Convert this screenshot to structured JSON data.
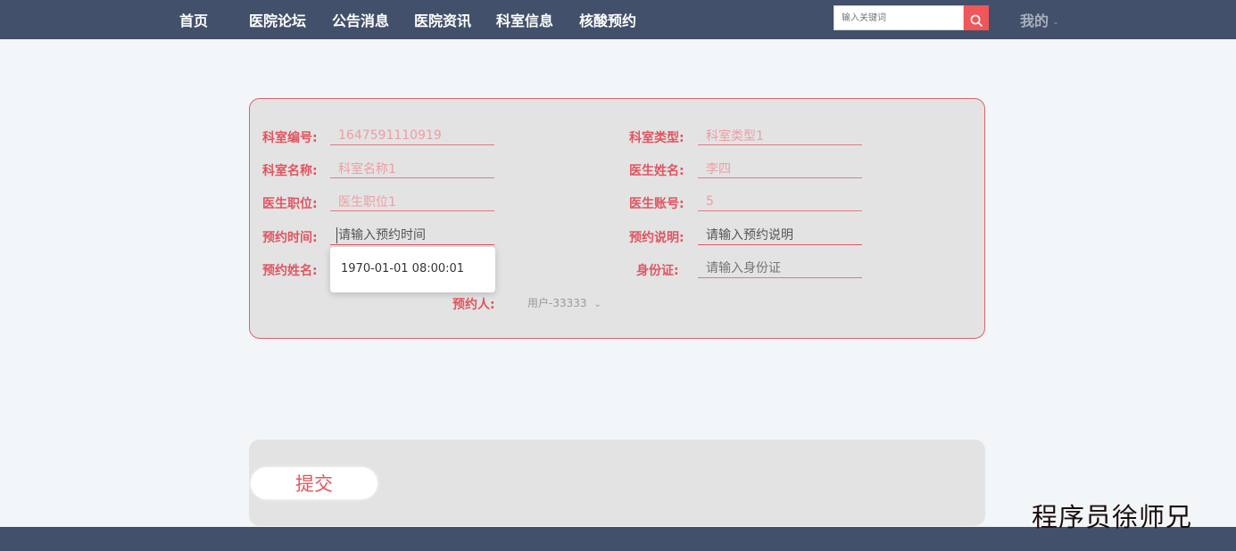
{
  "nav": {
    "items": [
      "首页",
      "医院论坛",
      "公告消息",
      "医院资讯",
      "科室信息",
      "核酸预约"
    ],
    "search_placeholder": "输入关键词",
    "search_icon": "search-icon",
    "user_menu": "我的",
    "user_caret": "-"
  },
  "form": {
    "dept_no_label": "科室编号:",
    "dept_no_value": "1647591110919",
    "dept_type_label": "科室类型:",
    "dept_type_value": "科室类型1",
    "dept_name_label": "科室名称:",
    "dept_name_value": "科室名称1",
    "doctor_name_label": "医生姓名:",
    "doctor_name_value": "李四",
    "doctor_title_label": "医生职位:",
    "doctor_title_value": "医生职位1",
    "doctor_account_label": "医生账号:",
    "doctor_account_value": "5",
    "appt_time_label": "预约时间:",
    "appt_time_placeholder": "请输入预约时间",
    "appt_desc_label": "预约说明:",
    "appt_desc_placeholder": "请输入预约说明",
    "appt_name_label": "预约姓名:",
    "id_card_label": "身份证:",
    "id_card_placeholder": "请输入身份证",
    "booker_label": "预约人:",
    "booker_value": "用户-33333",
    "booker_chevron": "⌄",
    "date_suggestion": "1970-01-01 08:00:01"
  },
  "submit_label": "提交",
  "watermark": "程序员徐师兄",
  "colors": {
    "header_bg": "#42506b",
    "accent": "#e05560",
    "panel_bg": "#e3e3e3",
    "search_btn": "#f0575a"
  }
}
